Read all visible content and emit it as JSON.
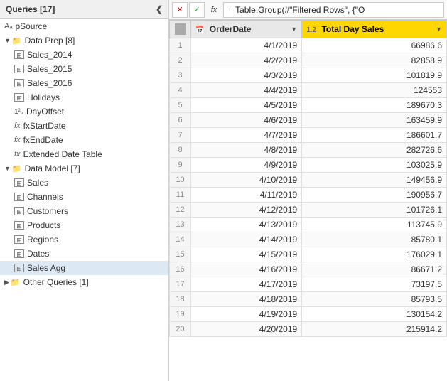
{
  "leftPanel": {
    "header": "Queries [17]",
    "items": [
      {
        "id": "pSource",
        "label": "pSource",
        "type": "param",
        "indent": 1,
        "selected": false
      },
      {
        "id": "dataPrep",
        "label": "Data Prep [8]",
        "type": "folder",
        "indent": 1,
        "expanded": true,
        "selected": false
      },
      {
        "id": "sales2014",
        "label": "Sales_2014",
        "type": "table",
        "indent": 2,
        "selected": false
      },
      {
        "id": "sales2015",
        "label": "Sales_2015",
        "type": "table",
        "indent": 2,
        "selected": false
      },
      {
        "id": "sales2016",
        "label": "Sales_2016",
        "type": "table",
        "indent": 2,
        "selected": false
      },
      {
        "id": "holidays",
        "label": "Holidays",
        "type": "table",
        "indent": 2,
        "selected": false
      },
      {
        "id": "dayOffset",
        "label": "DayOffset",
        "type": "num",
        "indent": 2,
        "selected": false
      },
      {
        "id": "fxStartDate",
        "label": "fxStartDate",
        "type": "fx",
        "indent": 2,
        "selected": false
      },
      {
        "id": "fxEndDate",
        "label": "fxEndDate",
        "type": "fx",
        "indent": 2,
        "selected": false
      },
      {
        "id": "extDateTable",
        "label": "Extended Date Table",
        "type": "fx",
        "indent": 2,
        "selected": false
      },
      {
        "id": "dataModel",
        "label": "Data Model [7]",
        "type": "folder",
        "indent": 1,
        "expanded": true,
        "selected": false
      },
      {
        "id": "sales",
        "label": "Sales",
        "type": "table",
        "indent": 2,
        "selected": false
      },
      {
        "id": "channels",
        "label": "Channels",
        "type": "table",
        "indent": 2,
        "selected": false
      },
      {
        "id": "customers",
        "label": "Customers",
        "type": "table",
        "indent": 2,
        "selected": false
      },
      {
        "id": "products",
        "label": "Products",
        "type": "table",
        "indent": 2,
        "selected": false
      },
      {
        "id": "regions",
        "label": "Regions",
        "type": "table",
        "indent": 2,
        "selected": false
      },
      {
        "id": "dates",
        "label": "Dates",
        "type": "table",
        "indent": 2,
        "selected": false
      },
      {
        "id": "salesAgg",
        "label": "Sales Agg",
        "type": "table",
        "indent": 2,
        "selected": true
      },
      {
        "id": "otherQueries",
        "label": "Other Queries [1]",
        "type": "folder",
        "indent": 1,
        "expanded": false,
        "selected": false
      }
    ]
  },
  "formulaBar": {
    "cancelLabel": "✕",
    "confirmLabel": "✓",
    "fxLabel": "fx",
    "formula": "= Table.Group(#\"Filtered Rows\", {\"O"
  },
  "table": {
    "columns": [
      {
        "id": "rownum",
        "label": "",
        "type": "rownum"
      },
      {
        "id": "orderdate",
        "label": "OrderDate",
        "type": "date",
        "typeIcon": "📅"
      },
      {
        "id": "totaldaysales",
        "label": "Total Day Sales",
        "type": "number",
        "typeIcon": "1.2"
      }
    ],
    "rows": [
      {
        "rownum": 1,
        "orderdate": "4/1/2019",
        "totaldaysales": "66986.6"
      },
      {
        "rownum": 2,
        "orderdate": "4/2/2019",
        "totaldaysales": "82858.9"
      },
      {
        "rownum": 3,
        "orderdate": "4/3/2019",
        "totaldaysales": "101819.9"
      },
      {
        "rownum": 4,
        "orderdate": "4/4/2019",
        "totaldaysales": "124553"
      },
      {
        "rownum": 5,
        "orderdate": "4/5/2019",
        "totaldaysales": "189670.3"
      },
      {
        "rownum": 6,
        "orderdate": "4/6/2019",
        "totaldaysales": "163459.9"
      },
      {
        "rownum": 7,
        "orderdate": "4/7/2019",
        "totaldaysales": "186601.7"
      },
      {
        "rownum": 8,
        "orderdate": "4/8/2019",
        "totaldaysales": "282726.6"
      },
      {
        "rownum": 9,
        "orderdate": "4/9/2019",
        "totaldaysales": "103025.9"
      },
      {
        "rownum": 10,
        "orderdate": "4/10/2019",
        "totaldaysales": "149456.9"
      },
      {
        "rownum": 11,
        "orderdate": "4/11/2019",
        "totaldaysales": "190956.7"
      },
      {
        "rownum": 12,
        "orderdate": "4/12/2019",
        "totaldaysales": "101726.1"
      },
      {
        "rownum": 13,
        "orderdate": "4/13/2019",
        "totaldaysales": "113745.9"
      },
      {
        "rownum": 14,
        "orderdate": "4/14/2019",
        "totaldaysales": "85780.1"
      },
      {
        "rownum": 15,
        "orderdate": "4/15/2019",
        "totaldaysales": "176029.1"
      },
      {
        "rownum": 16,
        "orderdate": "4/16/2019",
        "totaldaysales": "86671.2"
      },
      {
        "rownum": 17,
        "orderdate": "4/17/2019",
        "totaldaysales": "73197.5"
      },
      {
        "rownum": 18,
        "orderdate": "4/18/2019",
        "totaldaysales": "85793.5"
      },
      {
        "rownum": 19,
        "orderdate": "4/19/2019",
        "totaldaysales": "130154.2"
      },
      {
        "rownum": 20,
        "orderdate": "4/20/2019",
        "totaldaysales": "215914.2"
      }
    ]
  },
  "colors": {
    "selected": "#dde8f5",
    "folderYellow": "#e8a000",
    "highlightedCol": "#ffd700"
  }
}
